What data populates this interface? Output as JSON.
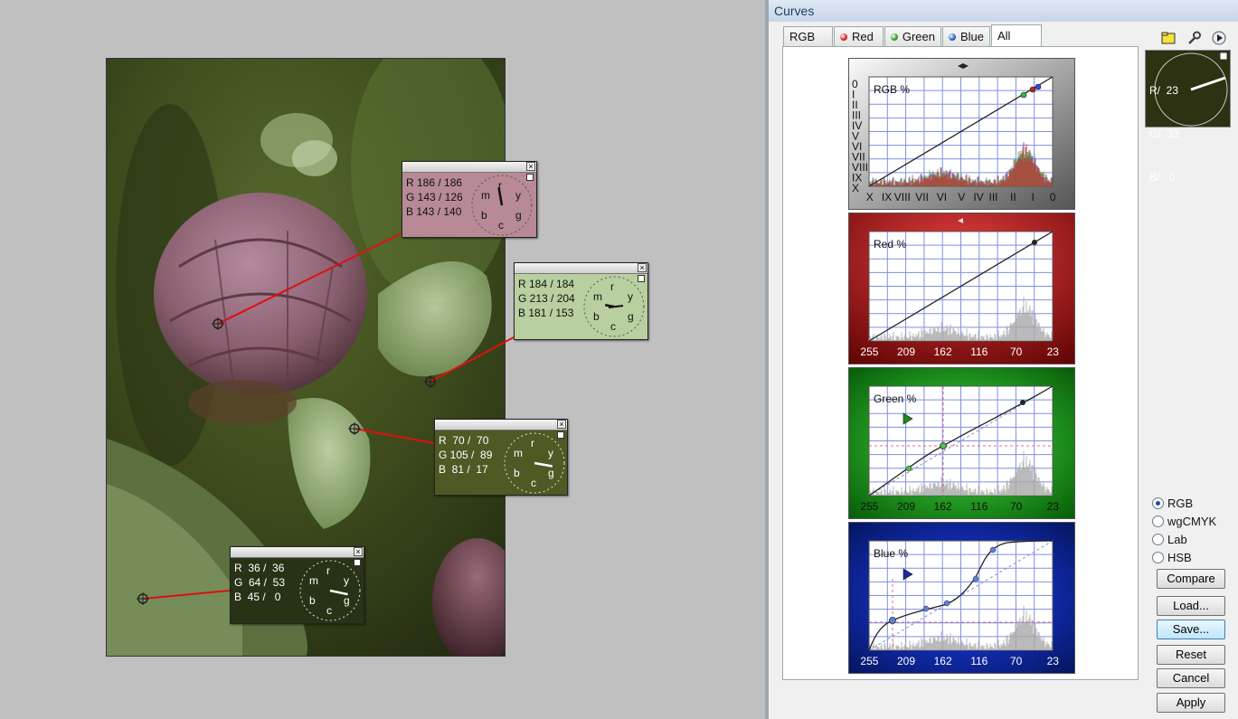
{
  "window": {
    "title": "Curves"
  },
  "tabs": [
    {
      "label": "RGB",
      "dot": ""
    },
    {
      "label": "Red",
      "dot": "#d02020"
    },
    {
      "label": "Green",
      "dot": "#20a020"
    },
    {
      "label": "Blue",
      "dot": "#2060c0"
    },
    {
      "label": "All",
      "dot": ""
    }
  ],
  "active_tab": "All",
  "toolbar": {
    "icons": [
      "folder-icon",
      "wrench-icon",
      "play-icon"
    ]
  },
  "pointer_readout": {
    "r": "R/  23",
    "g": "G/  33",
    "b": "B/   0"
  },
  "graphs": {
    "rgb": {
      "label": "RGB %",
      "x_ticks": [
        "X",
        "IX",
        "VIII",
        "VII",
        "VI",
        "V",
        "IV",
        "III",
        "II",
        "I",
        "0"
      ],
      "y_ticks": [
        "0",
        "I",
        "II",
        "III",
        "IV",
        "V",
        "VI",
        "VII",
        "VIII",
        "IX",
        "X"
      ]
    },
    "red": {
      "label": "Red %",
      "x_ticks": [
        "255",
        "209",
        "162",
        "116",
        "70",
        "23"
      ]
    },
    "green": {
      "label": "Green %",
      "x_ticks": [
        "255",
        "209",
        "162",
        "116",
        "70",
        "23"
      ]
    },
    "blue": {
      "label": "Blue %",
      "x_ticks": [
        "255",
        "209",
        "162",
        "116",
        "70",
        "23"
      ]
    }
  },
  "color_modes": [
    {
      "label": "RGB",
      "selected": true
    },
    {
      "label": "wgCMYK",
      "selected": false
    },
    {
      "label": "Lab",
      "selected": false
    },
    {
      "label": "HSB",
      "selected": false
    }
  ],
  "buttons": {
    "compare": "Compare",
    "load": "Load...",
    "save": "Save...",
    "reset": "Reset",
    "cancel": "Cancel",
    "apply": "Apply"
  },
  "probes": [
    {
      "r": "R 186 / 186",
      "g": "G 143 / 126",
      "b": "B 143 / 140",
      "bg": "#b78a96"
    },
    {
      "r": "R 184 / 184",
      "g": "G 213 / 204",
      "b": "B 181 / 153",
      "bg": "#b8cf9f"
    },
    {
      "r": "R  70 /  70",
      "g": "G 105 /  89",
      "b": "B  81 /  17",
      "bg": "#4d5a24"
    },
    {
      "r": "R  36 /  36",
      "g": "G  64 /  53",
      "b": "B  45 /   0",
      "bg": "#283316"
    }
  ],
  "wheel_labels": {
    "r": "r",
    "y": "y",
    "g": "g",
    "c": "c",
    "b": "b",
    "m": "m"
  }
}
